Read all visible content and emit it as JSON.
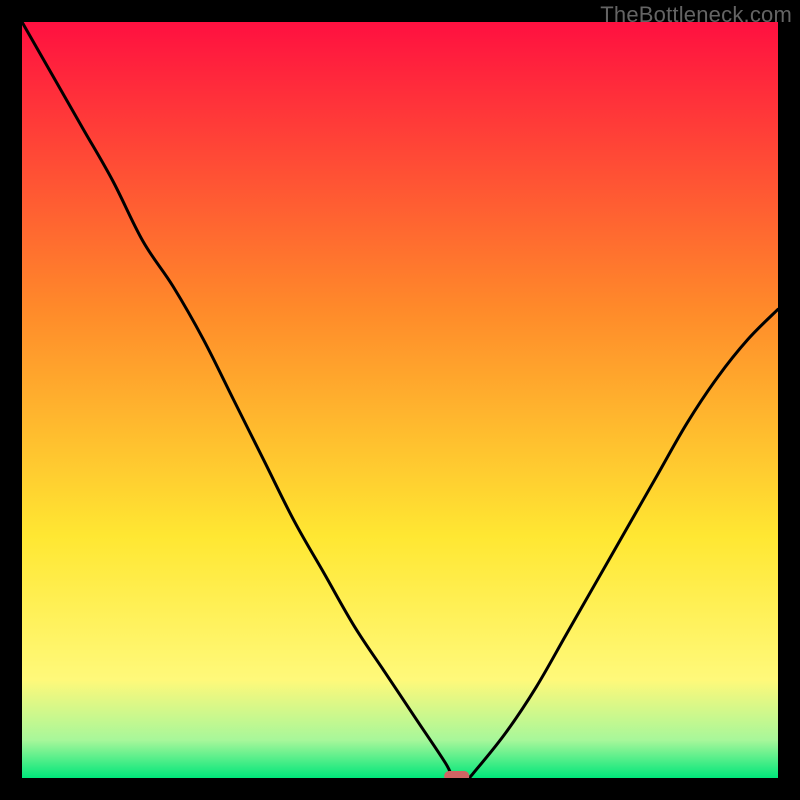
{
  "watermark": "TheBottleneck.com",
  "colors": {
    "frame": "#000000",
    "curve": "#000000",
    "marker_fill": "#d06464",
    "marker_stroke": "#d06464",
    "grad_top": "#ff1040",
    "grad_mid1": "#ff8a2a",
    "grad_mid2": "#ffe732",
    "grad_low": "#fff97a",
    "grad_green_light": "#a7f79a",
    "grad_green": "#00e67a"
  },
  "chart_data": {
    "type": "line",
    "title": "",
    "xlabel": "",
    "ylabel": "",
    "xlim": [
      0,
      100
    ],
    "ylim": [
      0,
      100
    ],
    "x": [
      0,
      4,
      8,
      12,
      16,
      20,
      24,
      28,
      32,
      36,
      40,
      44,
      48,
      52,
      56,
      57,
      58,
      59,
      60,
      64,
      68,
      72,
      76,
      80,
      84,
      88,
      92,
      96,
      100
    ],
    "values": [
      100,
      93,
      86,
      79,
      71,
      65,
      58,
      50,
      42,
      34,
      27,
      20,
      14,
      8,
      2,
      0,
      0,
      0,
      1,
      6,
      12,
      19,
      26,
      33,
      40,
      47,
      53,
      58,
      62
    ],
    "optimum": {
      "x": 57.5,
      "y": 0,
      "width": 3.2,
      "height": 1.2
    }
  }
}
